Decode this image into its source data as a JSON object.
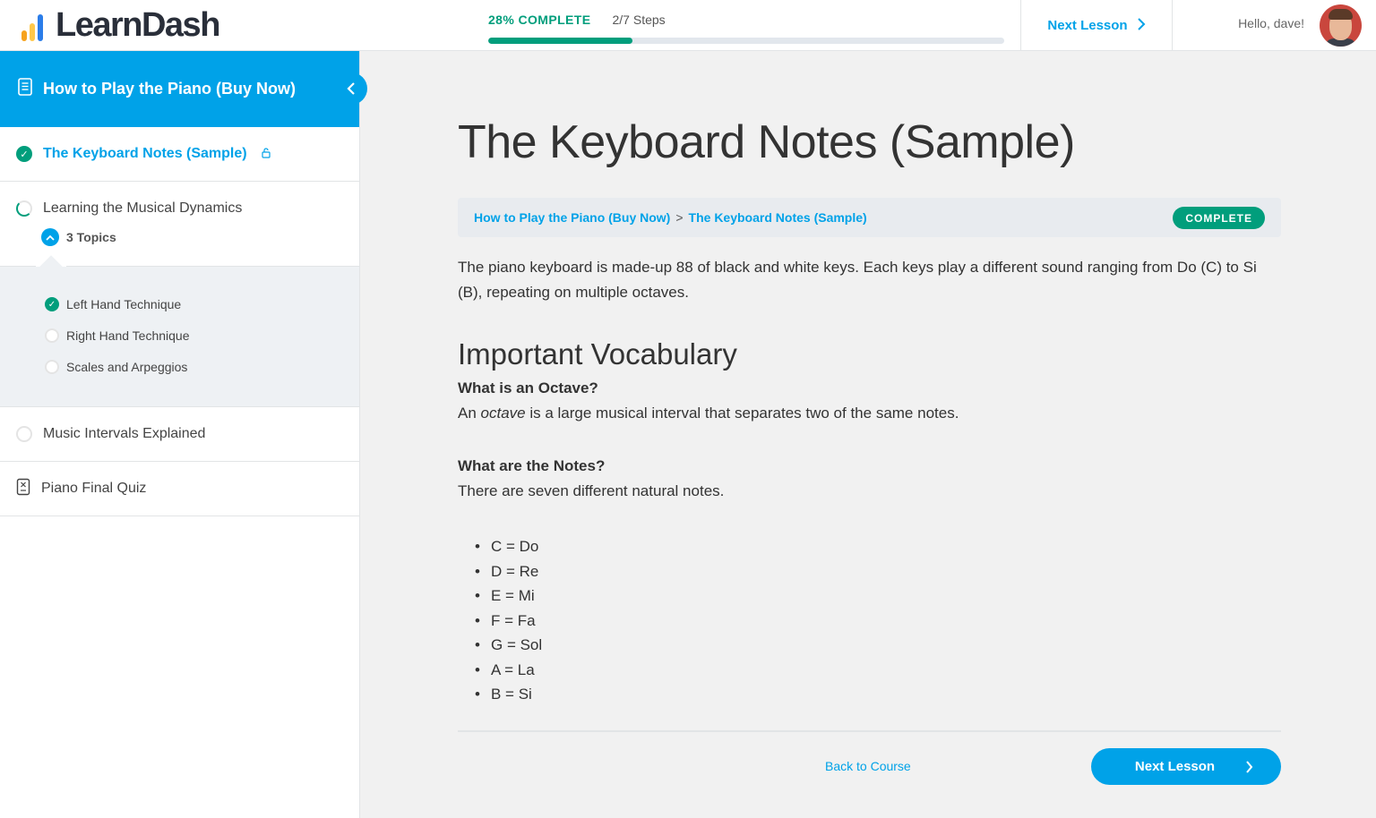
{
  "header": {
    "logo_text": "LearnDash",
    "progress_pct_label": "28% COMPLETE",
    "progress_value": 0.28,
    "steps_label": "2/7 Steps",
    "next_lesson_label": "Next Lesson",
    "greeting": "Hello, dave!"
  },
  "colors": {
    "brand_blue": "#00a2e8",
    "complete_green": "#019e7c",
    "logo_bar_orange": "#f6a21e",
    "logo_bar_yellow": "#ffc84a",
    "logo_bar_blue": "#2b7de9"
  },
  "sidebar": {
    "course_title": "How to Play the Piano (Buy Now)",
    "lessons": [
      {
        "label": "The Keyboard Notes (Sample)",
        "status": "complete",
        "active": true,
        "sample": true
      },
      {
        "label": "Learning the Musical Dynamics",
        "status": "in-progress",
        "topics_label": "3 Topics"
      },
      {
        "label": "Music Intervals Explained",
        "status": "not-started"
      },
      {
        "label": "Piano Final Quiz",
        "status": "quiz"
      }
    ],
    "topics": [
      {
        "label": "Left Hand Technique",
        "status": "complete"
      },
      {
        "label": "Right Hand Technique",
        "status": "not-started"
      },
      {
        "label": "Scales and Arpeggios",
        "status": "not-started"
      }
    ]
  },
  "main": {
    "title": "The Keyboard Notes (Sample)",
    "breadcrumb": {
      "course": "How to Play the Piano (Buy Now)",
      "separator": ">",
      "lesson": "The Keyboard Notes (Sample)",
      "status_badge": "COMPLETE"
    },
    "intro": "The piano keyboard is made-up 88 of black and white keys. Each keys play a different sound ranging from Do (C) to Si (B), repeating on multiple octaves.",
    "section_heading": "Important Vocabulary",
    "q1": "What is an Octave?",
    "a1_pre": "An ",
    "a1_em": "octave",
    "a1_post": " is a large musical interval that separates two of the same notes.",
    "q2": "What are the Notes?",
    "a2": "There are seven different natural notes.",
    "notes": [
      "C = Do",
      "D = Re",
      "E = Mi",
      "F = Fa",
      "G = Sol",
      "A = La",
      "B = Si"
    ],
    "back_label": "Back to Course",
    "next_label": "Next Lesson"
  }
}
